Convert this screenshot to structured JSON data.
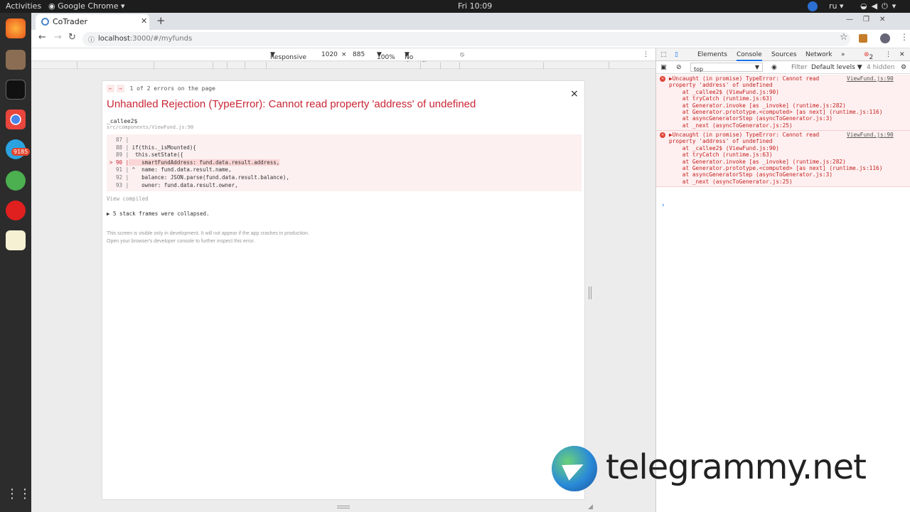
{
  "system": {
    "activities": "Activities",
    "app_name": "Google Chrome",
    "clock": "Fri 10:09",
    "language": "ru",
    "dock_badge": "9185"
  },
  "browser": {
    "tab_title": "CoTrader",
    "url_host": "localhost",
    "url_rest": ":3000/#/myfunds"
  },
  "device_toolbar": {
    "mode": "Responsive",
    "width": "1020",
    "separator": "×",
    "height": "885",
    "zoom": "100%",
    "throttling": "No throttling"
  },
  "error_overlay": {
    "nav_prev": "←",
    "nav_next": "→",
    "counter": "1 of 2 errors on the page",
    "close": "×",
    "headline": "Unhandled Rejection (TypeError): Cannot read property 'address' of undefined",
    "function_name": "_callee2$",
    "file_path": "src/components/ViewFund.js:90",
    "code_lines": [
      {
        "gutter": "  87 |",
        "code": ""
      },
      {
        "gutter": "  88 |",
        "code": " if(this._isMounted){"
      },
      {
        "gutter": "  89 |",
        "code": "  this.setState({"
      },
      {
        "gutter": "> 90 |",
        "code": "    smartFundAddress: fund.data.result.address,"
      },
      {
        "gutter": "  91 |",
        "code": " ^  name: fund.data.result.name,"
      },
      {
        "gutter": "  92 |",
        "code": "    balance: JSON.parse(fund.data.result.balance),"
      },
      {
        "gutter": "  93 |",
        "code": "    owner: fund.data.result.owner,"
      }
    ],
    "view_compiled": "View compiled",
    "collapsed_frames": "▶ 5 stack frames were collapsed.",
    "dev_note_1": "This screen is visible only in development. It will not appear if the app crashes in production.",
    "dev_note_2": "Open your browser's developer console to further inspect this error."
  },
  "devtools": {
    "tabs": [
      "Elements",
      "Console",
      "Sources",
      "Network"
    ],
    "more_tabs": "»",
    "error_count": "2",
    "context": "top",
    "filter_placeholder": "Filter",
    "levels": "Default levels ▼",
    "hidden": "4 hidden",
    "messages": [
      {
        "source": "ViewFund.js:90",
        "lines": [
          "▶Uncaught (in promise) TypeError: Cannot read",
          "property 'address' of undefined",
          "    at _callee2$ (ViewFund.js:90)",
          "    at tryCatch (runtime.js:63)",
          "    at Generator.invoke [as _invoke] (runtime.js:282)",
          "    at Generator.prototype.<computed> [as next] (runtime.js:116)",
          "    at asyncGeneratorStep (asyncToGenerator.js:3)",
          "    at _next (asyncToGenerator.js:25)"
        ]
      },
      {
        "source": "ViewFund.js:90",
        "lines": [
          "▶Uncaught (in promise) TypeError: Cannot read",
          "property 'address' of undefined",
          "    at _callee2$ (ViewFund.js:90)",
          "    at tryCatch (runtime.js:63)",
          "    at Generator.invoke [as _invoke] (runtime.js:282)",
          "    at Generator.prototype.<computed> [as next] (runtime.js:116)",
          "    at asyncGeneratorStep (asyncToGenerator.js:3)",
          "    at _next (asyncToGenerator.js:25)"
        ]
      }
    ],
    "prompt": "›"
  },
  "watermark": {
    "text": "telegrammy.net"
  },
  "colors": {
    "error_red": "#c92636",
    "console_error": "#c41d1d",
    "accent": "#1a73e8"
  }
}
